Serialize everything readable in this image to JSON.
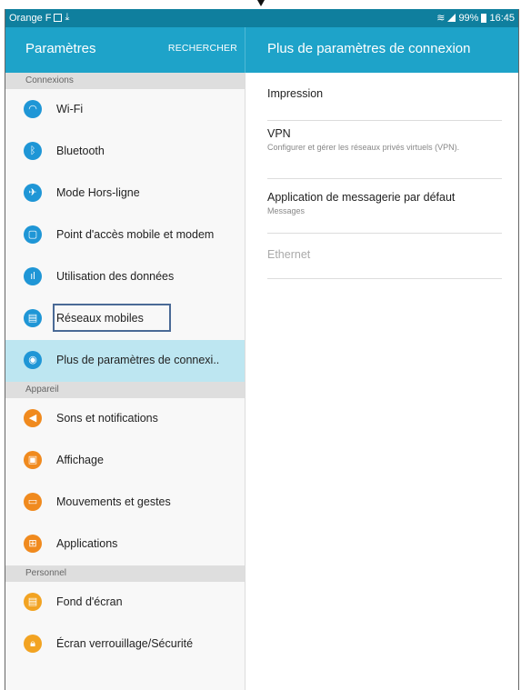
{
  "status_bar": {
    "carrier": "Orange F",
    "battery": "99%",
    "time": "16:45"
  },
  "header": {
    "title": "Paramètres",
    "search": "RECHERCHER",
    "detail_title": "Plus de paramètres de connexion"
  },
  "sections": {
    "connexions": "Connexions",
    "appareil": "Appareil",
    "personnel": "Personnel"
  },
  "menu": {
    "wifi": "Wi-Fi",
    "bluetooth": "Bluetooth",
    "hors_ligne": "Mode Hors-ligne",
    "point_acces": "Point d'accès mobile et modem",
    "utilisation": "Utilisation des données",
    "reseaux": "Réseaux mobiles",
    "plus": "Plus de paramètres de connexi..",
    "sons": "Sons et notifications",
    "affichage": "Affichage",
    "mouvements": "Mouvements et gestes",
    "applications": "Applications",
    "fond": "Fond d'écran",
    "verrouillage": "Écran verrouillage/Sécurité"
  },
  "detail": {
    "impression": "Impression",
    "vpn_title": "VPN",
    "vpn_sub": "Configurer et gérer les réseaux privés virtuels (VPN).",
    "messagerie_title": "Application de messagerie par défaut",
    "messagerie_sub": "Messages",
    "ethernet": "Ethernet"
  },
  "colors": {
    "status_bar": "#0f7f9e",
    "header": "#1ea3c9",
    "selected_row": "#bde6f1",
    "icon_blue": "#1f96d6",
    "icon_orange": "#f08a1e",
    "icon_amber": "#f2a322"
  }
}
